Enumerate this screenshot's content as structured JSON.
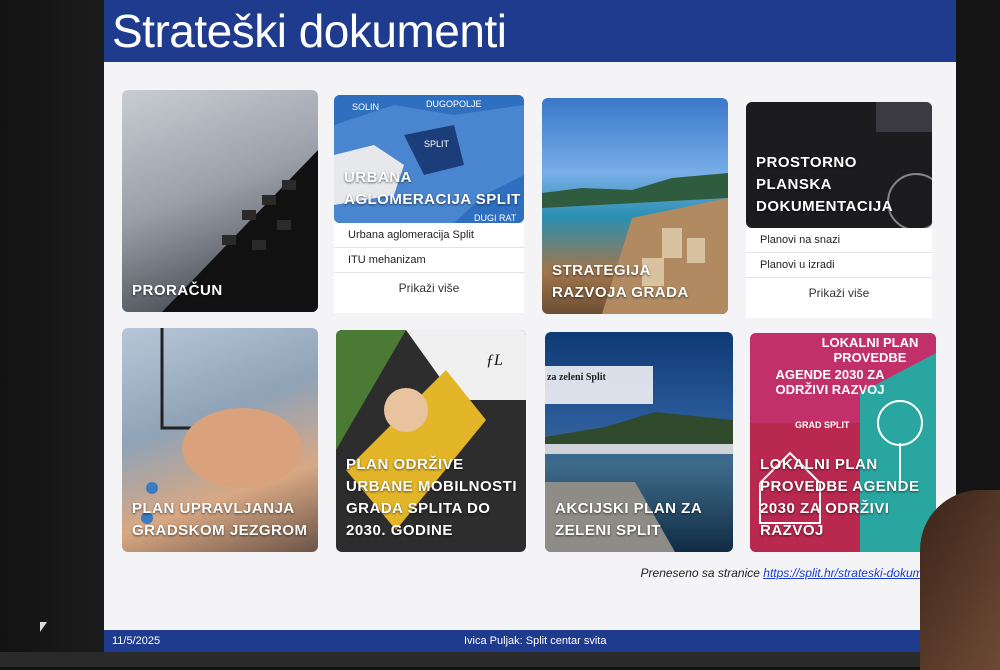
{
  "title": "Strateški dokumenti",
  "cards": {
    "proracun": {
      "label": "PRORAČUN"
    },
    "urbana": {
      "label": "URBANA AGLOMERACIJA SPLIT",
      "map_labels": [
        "SOLIN",
        "DUGOPOLJE",
        "SPLIT",
        "DUGI RAT"
      ],
      "links": [
        "Urbana aglomeracija Split",
        "ITU mehanizam"
      ],
      "more": "Prikaži više"
    },
    "strategija": {
      "label": "STRATEGIJA RAZVOJA GRADA"
    },
    "prostorno": {
      "label": "PROSTORNO PLANSKA DOKUMENTACIJA",
      "links": [
        "Planovi na snazi",
        "Planovi u izradi"
      ],
      "more": "Prikaži više"
    },
    "jezgra": {
      "label": "PLAN UPRAVLJANJA GRADSKOM JEZGROM"
    },
    "mobilnost": {
      "label": "PLAN ODRŽIVE URBANE MOBILNOSTI GRADA SPLITA DO 2030. GODINE"
    },
    "zeleni": {
      "label": "AKCIJSKI PLAN ZA ZELENI SPLIT",
      "banner": "za zeleni Split"
    },
    "agenda": {
      "label": "LOKALNI PLAN PROVEDBE AGENDE 2030 ZA ODRŽIVI RAZVOJ",
      "poster_title": "LOKALNI PLAN PROVEDBE",
      "poster_sub": "AGENDE 2030 ZA ODRŽIVI RAZVOJ",
      "grad": "GRAD SPLIT"
    }
  },
  "source": {
    "prefix": "Preneseno sa stranice ",
    "url": "https://split.hr/strateski-dokumenti"
  },
  "footer": {
    "date": "11/5/2025",
    "center": "Ivica Puljak: Split centar svita"
  },
  "colors": {
    "blue": "#1f3b8e",
    "magenta": "#c2306a",
    "teal": "#2aa6a0"
  }
}
